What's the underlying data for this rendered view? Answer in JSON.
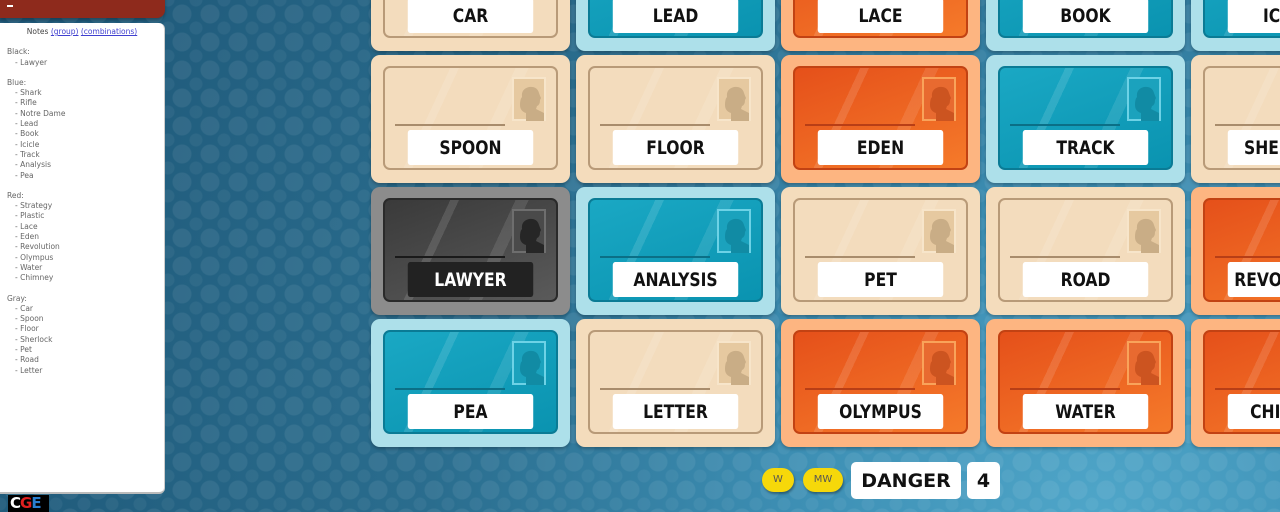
{
  "notes": {
    "title": "Notes",
    "links": [
      "(group)",
      "(combinations)"
    ],
    "groups": [
      {
        "name": "Black:",
        "items": [
          "- Lawyer"
        ]
      },
      {
        "name": "Blue:",
        "items": [
          "- Shark",
          "- Rifle",
          "- Notre Dame",
          "- Lead",
          "- Book",
          "- Icicle",
          "- Track",
          "- Analysis",
          "- Pea"
        ]
      },
      {
        "name": "Red:",
        "items": [
          "- Strategy",
          "- Plastic",
          "- Lace",
          "- Eden",
          "- Revolution",
          "- Olympus",
          "- Water",
          "- Chimney"
        ]
      },
      {
        "name": "Gray:",
        "items": [
          "- Car",
          "- Spoon",
          "- Floor",
          "- Sherlock",
          "- Pet",
          "- Road",
          "- Letter"
        ]
      }
    ]
  },
  "logo": {
    "c": "C",
    "g": "G",
    "e": "E"
  },
  "board": {
    "rows": [
      [
        {
          "word": "CAR",
          "team": "gray"
        },
        {
          "word": "LEAD",
          "team": "blue"
        },
        {
          "word": "LACE",
          "team": "red"
        },
        {
          "word": "BOOK",
          "team": "blue"
        },
        {
          "word": "ICICLE",
          "team": "blue"
        }
      ],
      [
        {
          "word": "SPOON",
          "team": "gray"
        },
        {
          "word": "FLOOR",
          "team": "gray"
        },
        {
          "word": "EDEN",
          "team": "red"
        },
        {
          "word": "TRACK",
          "team": "blue"
        },
        {
          "word": "SHERLOCK",
          "team": "gray"
        }
      ],
      [
        {
          "word": "LAWYER",
          "team": "black"
        },
        {
          "word": "ANALYSIS",
          "team": "blue"
        },
        {
          "word": "PET",
          "team": "gray"
        },
        {
          "word": "ROAD",
          "team": "gray"
        },
        {
          "word": "REVOLUTION",
          "team": "red"
        }
      ],
      [
        {
          "word": "PEA",
          "team": "blue"
        },
        {
          "word": "LETTER",
          "team": "gray"
        },
        {
          "word": "OLYMPUS",
          "team": "red"
        },
        {
          "word": "WATER",
          "team": "red"
        },
        {
          "word": "CHIMNEY",
          "team": "red"
        }
      ]
    ]
  },
  "controls": {
    "w_label": "W",
    "mw_label": "MW",
    "clue_word": "DANGER",
    "clue_count": "4"
  }
}
